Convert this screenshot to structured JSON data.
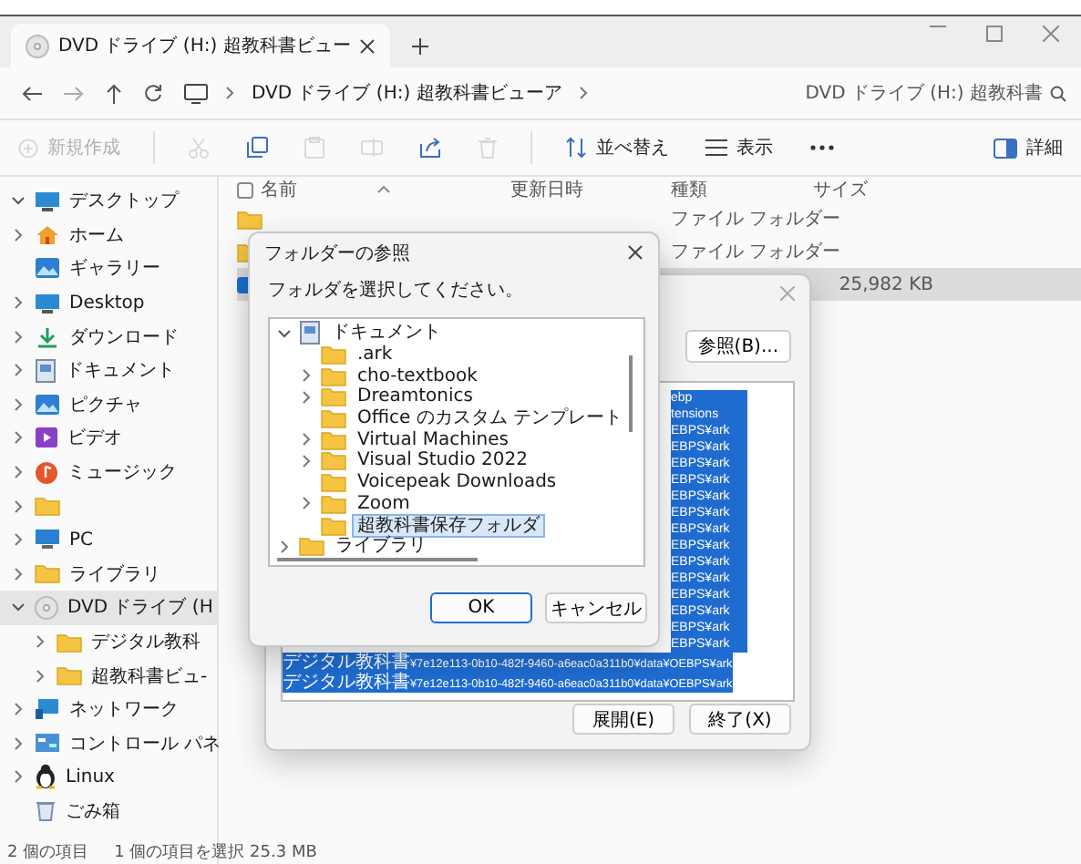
{
  "explorer": {
    "tab": {
      "title": "DVD ドライブ (H:) 超教科書ビュー"
    },
    "address": {
      "path": "DVD ドライブ (H:) 超教科書ビューア"
    },
    "search": {
      "placeholder": "DVD ドライブ (H:) 超教科書"
    },
    "toolbar": [
      {
        "kind": "new",
        "label": "新規作成",
        "disabled": true
      },
      {
        "kind": "cut",
        "disabled": true
      },
      {
        "kind": "copy",
        "disabled": false
      },
      {
        "kind": "paste",
        "disabled": true
      },
      {
        "kind": "rename",
        "disabled": true
      },
      {
        "kind": "share",
        "disabled": false
      },
      {
        "kind": "delete",
        "disabled": true
      },
      {
        "kind": "sort",
        "label": "並べ替え",
        "disabled": false
      },
      {
        "kind": "view",
        "label": "表示",
        "disabled": false
      },
      {
        "kind": "more",
        "disabled": false
      },
      {
        "kind": "details",
        "label": "詳細",
        "disabled": false
      }
    ],
    "sidebar": [
      {
        "label": "デスクトップ",
        "kind": "desktop",
        "expandable": true,
        "expanded": true,
        "selected": false
      },
      {
        "label": "ホーム",
        "kind": "home",
        "expandable": true,
        "expanded": false,
        "selected": false
      },
      {
        "label": "ギャラリー",
        "kind": "gallery",
        "expandable": false,
        "selected": false
      },
      {
        "label": "Desktop",
        "kind": "desktop",
        "expandable": true,
        "expanded": false,
        "selected": false
      },
      {
        "label": "ダウンロード",
        "kind": "download",
        "expandable": true,
        "expanded": false,
        "selected": false
      },
      {
        "label": "ドキュメント",
        "kind": "document",
        "expandable": true,
        "expanded": false,
        "selected": false
      },
      {
        "label": "ピクチャ",
        "kind": "gallery",
        "expandable": true,
        "expanded": false,
        "selected": false
      },
      {
        "label": "ビデオ",
        "kind": "video",
        "expandable": true,
        "expanded": false,
        "selected": false
      },
      {
        "label": "ミュージック",
        "kind": "music",
        "expandable": true,
        "expanded": false,
        "selected": false
      },
      {
        "kind": "folder",
        "expandable": true,
        "expanded": false,
        "selected": false
      },
      {
        "label": "PC",
        "kind": "pc",
        "expandable": true,
        "expanded": false,
        "selected": false
      },
      {
        "label": "ライブラリ",
        "kind": "folder",
        "expandable": true,
        "expanded": false,
        "selected": false
      },
      {
        "label": "DVD ドライブ (H",
        "kind": "disc",
        "expandable": true,
        "expanded": true,
        "selected": true,
        "children": [
          {
            "label": "デジタル教科",
            "kind": "folder",
            "expandable": true,
            "expanded": false,
            "selected": false
          },
          {
            "label": "超教科書ビュ-",
            "kind": "folder",
            "expandable": true,
            "expanded": false,
            "selected": false
          }
        ]
      },
      {
        "label": "ネットワーク",
        "kind": "network",
        "expandable": true,
        "expanded": false,
        "selected": false
      },
      {
        "label": "コントロール パネ",
        "kind": "control",
        "expandable": true,
        "expanded": false,
        "selected": false
      },
      {
        "label": "Linux",
        "kind": "linux",
        "expandable": true,
        "expanded": false,
        "selected": false
      },
      {
        "label": "ごみ箱",
        "kind": "trash",
        "expandable": false,
        "selected": false
      }
    ],
    "select_all": {
      "checked": false
    },
    "columns": [
      "名前",
      "更新日時",
      "種類",
      "サイズ"
    ],
    "rows": [
      {
        "type": "ファイル フォルダー",
        "selected": false
      },
      {
        "type": "ファイル フォルダー",
        "selected": false
      },
      {
        "size": "25,982 KB",
        "selected": true
      }
    ],
    "status": [
      "2 個の項目",
      "1 個の項目を選択 25.3 MB"
    ]
  },
  "extract_dialog": {
    "browse_button": "参照(B)...",
    "lines": [
      {
        "kind": "fragment",
        "text": "ebp"
      },
      {
        "kind": "fragment",
        "text": "tensions"
      },
      {
        "kind": "fragment",
        "text": "EBPS¥ark"
      },
      {
        "kind": "fragment",
        "text": "EBPS¥ark"
      },
      {
        "kind": "fragment",
        "text": "EBPS¥ark"
      },
      {
        "kind": "fragment",
        "text": "EBPS¥ark"
      },
      {
        "kind": "fragment",
        "text": "EBPS¥ark"
      },
      {
        "kind": "fragment",
        "text": "EBPS¥ark"
      },
      {
        "kind": "fragment",
        "text": "EBPS¥ark"
      },
      {
        "kind": "fragment",
        "text": "EBPS¥ark"
      },
      {
        "kind": "fragment",
        "text": "EBPS¥ark"
      },
      {
        "kind": "fragment",
        "text": "EBPS¥ark"
      },
      {
        "kind": "fragment",
        "text": "EBPS¥ark"
      },
      {
        "kind": "fragment",
        "text": "EBPS¥ark"
      },
      {
        "kind": "fragment",
        "text": "EBPS¥ark"
      },
      {
        "kind": "fragment",
        "text": "EBPS¥ark"
      },
      {
        "kind": "path",
        "folder": "デジタル教科書",
        "text": "¥7e12e113-0b10-482f-9460-a6eac0a311b0¥data¥OEBPS¥ark"
      },
      {
        "kind": "path",
        "folder": "デジタル教科書",
        "text": "¥7e12e113-0b10-482f-9460-a6eac0a311b0¥data¥OEBPS¥ark"
      }
    ],
    "buttons": [
      "展開(E)",
      "終了(X)"
    ]
  },
  "folder_dialog": {
    "title": "フォルダーの参照",
    "prompt": "フォルダを選択してください。",
    "tree": [
      {
        "label": "ドキュメント",
        "kind": "document",
        "expandable": true,
        "expanded": true,
        "selected": false,
        "children": [
          {
            "label": ".ark",
            "expandable": false,
            "selected": false
          },
          {
            "label": "cho-textbook",
            "expandable": true,
            "expanded": false,
            "selected": false
          },
          {
            "label": "Dreamtonics",
            "expandable": true,
            "expanded": false,
            "selected": false
          },
          {
            "label": "Office のカスタム テンプレート",
            "expandable": false,
            "selected": false
          },
          {
            "label": "Virtual Machines",
            "expandable": true,
            "expanded": false,
            "selected": false
          },
          {
            "label": "Visual Studio 2022",
            "expandable": true,
            "expanded": false,
            "selected": false
          },
          {
            "label": "Voicepeak Downloads",
            "expandable": false,
            "selected": false
          },
          {
            "label": "Zoom",
            "expandable": true,
            "expanded": false,
            "selected": false
          },
          {
            "label": "超教科書保存フォルダ",
            "expandable": false,
            "selected": true
          }
        ]
      },
      {
        "label": "ライブラリ",
        "kind": "folder",
        "expandable": true,
        "expanded": false,
        "selected": false
      }
    ],
    "buttons": [
      {
        "label": "OK",
        "default": true
      },
      {
        "label": "キャンセル",
        "default": false
      }
    ]
  }
}
